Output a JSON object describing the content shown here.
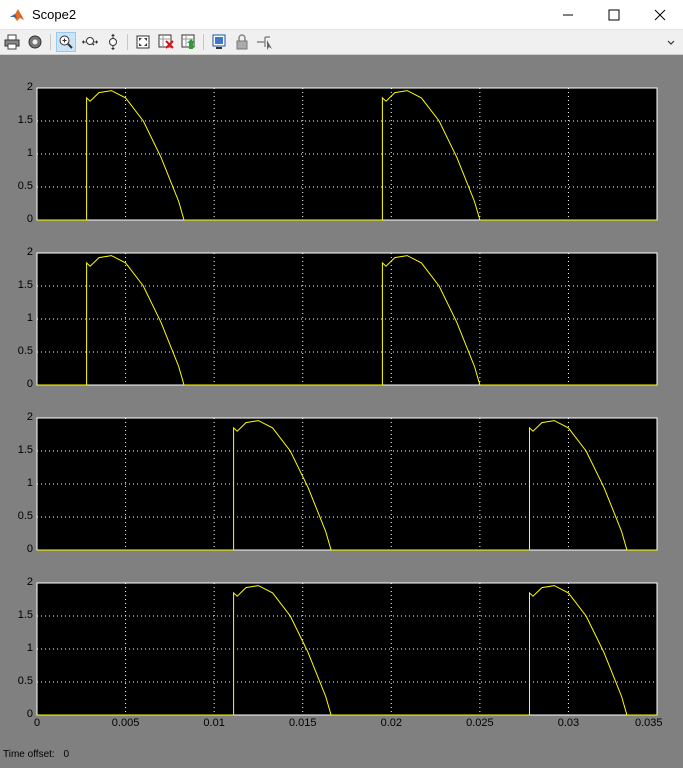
{
  "window": {
    "title": "Scope2",
    "minimize_icon": "minimize-icon",
    "maximize_icon": "maximize-icon",
    "close_icon": "close-icon"
  },
  "toolbar": {
    "buttons": [
      {
        "name": "print-button",
        "icon": "printer-icon"
      },
      {
        "name": "parameters-button",
        "icon": "gear-icon"
      },
      {
        "name": "zoom-in-button",
        "icon": "zoom-in-icon",
        "active": true
      },
      {
        "name": "zoom-x-button",
        "icon": "zoom-x-icon"
      },
      {
        "name": "zoom-y-button",
        "icon": "zoom-y-icon"
      },
      {
        "name": "autoscale-button",
        "icon": "autoscale-icon"
      },
      {
        "name": "save-axes-button",
        "icon": "save-axes-icon"
      },
      {
        "name": "restore-axes-button",
        "icon": "restore-axes-icon"
      },
      {
        "name": "floating-scope-button",
        "icon": "floating-scope-icon"
      },
      {
        "name": "lock-axes-button",
        "icon": "lock-icon"
      },
      {
        "name": "signal-selection-button",
        "icon": "signal-selection-icon"
      }
    ],
    "overflow_icon": "chevron-icon"
  },
  "status": {
    "time_offset_label": "Time offset:",
    "time_offset_value": "0"
  },
  "colors": {
    "figure_bg": "#808080",
    "axes_bg": "#000000",
    "trace": "#ffff00",
    "grid": "#ffffff",
    "axes_border": "#ffffff"
  },
  "chart_data": [
    {
      "type": "line",
      "xlim": [
        0,
        0.035
      ],
      "ylim": [
        0,
        2
      ],
      "yticks": [
        "0",
        "0.5",
        "1",
        "1.5",
        "2"
      ],
      "grid": true,
      "series": [
        {
          "x": [
            0,
            0.0028,
            0.0028,
            0.003,
            0.0035,
            0.0042,
            0.005,
            0.006,
            0.007,
            0.008,
            0.0083,
            0.0195,
            0.0195,
            0.0197,
            0.0202,
            0.0209,
            0.0217,
            0.0227,
            0.0237,
            0.0247,
            0.025,
            0.035
          ],
          "y": [
            0,
            0,
            1.85,
            1.8,
            1.93,
            1.96,
            1.85,
            1.5,
            0.95,
            0.28,
            0,
            0,
            1.85,
            1.8,
            1.93,
            1.96,
            1.85,
            1.5,
            0.95,
            0.28,
            0,
            0
          ]
        }
      ]
    },
    {
      "type": "line",
      "xlim": [
        0,
        0.035
      ],
      "ylim": [
        0,
        2
      ],
      "yticks": [
        "0",
        "0.5",
        "1",
        "1.5",
        "2"
      ],
      "grid": true,
      "series": [
        {
          "x": [
            0,
            0.0028,
            0.0028,
            0.003,
            0.0035,
            0.0042,
            0.005,
            0.006,
            0.007,
            0.008,
            0.0083,
            0.0195,
            0.0195,
            0.0197,
            0.0202,
            0.0209,
            0.0217,
            0.0227,
            0.0237,
            0.0247,
            0.025,
            0.035
          ],
          "y": [
            0,
            0,
            1.85,
            1.8,
            1.93,
            1.96,
            1.85,
            1.5,
            0.95,
            0.28,
            0,
            0,
            1.85,
            1.8,
            1.93,
            1.96,
            1.85,
            1.5,
            0.95,
            0.28,
            0,
            0
          ]
        }
      ]
    },
    {
      "type": "line",
      "xlim": [
        0,
        0.035
      ],
      "ylim": [
        0,
        2
      ],
      "yticks": [
        "0",
        "0.5",
        "1",
        "1.5",
        "2"
      ],
      "grid": true,
      "series": [
        {
          "x": [
            0,
            0.0111,
            0.0111,
            0.0113,
            0.0118,
            0.0125,
            0.0133,
            0.0143,
            0.0153,
            0.0163,
            0.0166,
            0.0278,
            0.0278,
            0.028,
            0.0285,
            0.0292,
            0.03,
            0.031,
            0.032,
            0.033,
            0.0333,
            0.035
          ],
          "y": [
            0,
            0,
            1.85,
            1.8,
            1.93,
            1.96,
            1.85,
            1.5,
            0.95,
            0.28,
            0,
            0,
            1.85,
            1.8,
            1.93,
            1.96,
            1.85,
            1.5,
            0.95,
            0.28,
            0,
            0
          ]
        }
      ]
    },
    {
      "type": "line",
      "xlim": [
        0,
        0.035
      ],
      "ylim": [
        0,
        2
      ],
      "yticks": [
        "0",
        "0.5",
        "1",
        "1.5",
        "2"
      ],
      "xticks": [
        "0",
        "0.005",
        "0.01",
        "0.015",
        "0.02",
        "0.025",
        "0.03",
        "0.035"
      ],
      "grid": true,
      "series": [
        {
          "x": [
            0,
            0.0111,
            0.0111,
            0.0113,
            0.0118,
            0.0125,
            0.0133,
            0.0143,
            0.0153,
            0.0163,
            0.0166,
            0.0278,
            0.0278,
            0.028,
            0.0285,
            0.0292,
            0.03,
            0.031,
            0.032,
            0.033,
            0.0333,
            0.035
          ],
          "y": [
            0,
            0,
            1.85,
            1.8,
            1.93,
            1.96,
            1.85,
            1.5,
            0.95,
            0.28,
            0,
            0,
            1.85,
            1.8,
            1.93,
            1.96,
            1.85,
            1.5,
            0.95,
            0.28,
            0,
            0
          ]
        }
      ]
    }
  ]
}
